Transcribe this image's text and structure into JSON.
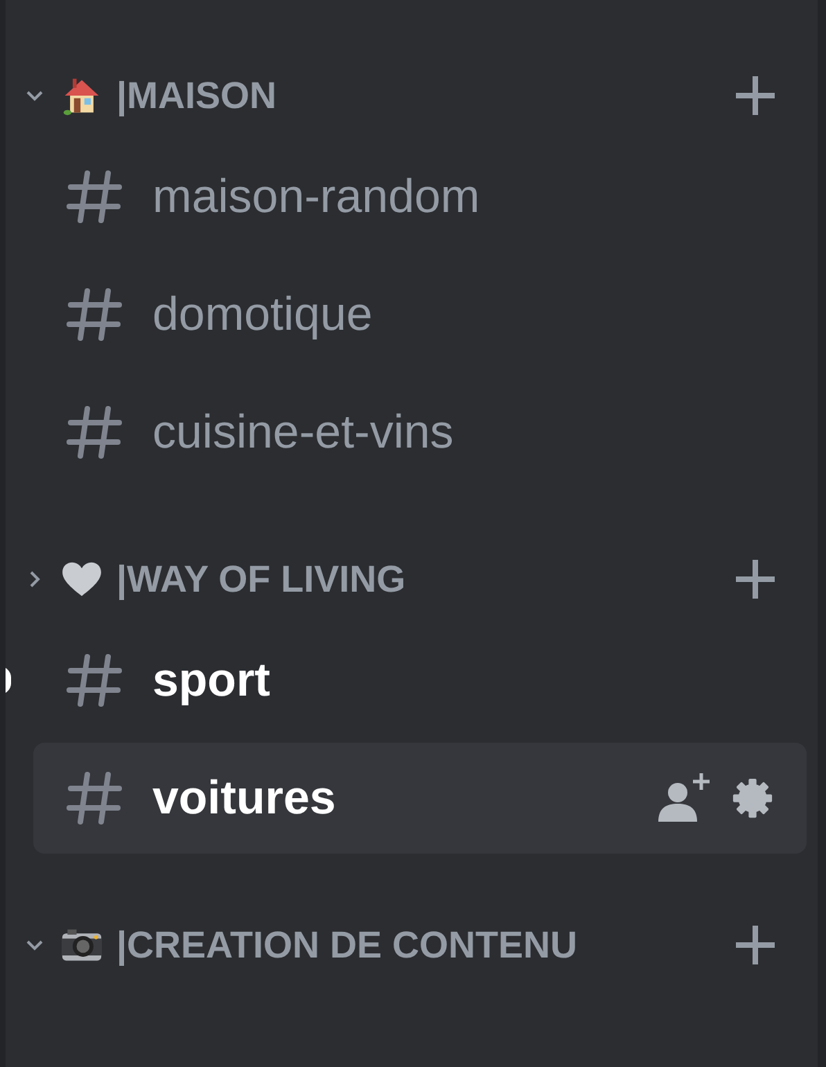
{
  "categories": [
    {
      "name": "|MAISON",
      "expanded": true,
      "channels": [
        {
          "name": "maison-random",
          "unread": false,
          "selected": false
        },
        {
          "name": "domotique",
          "unread": false,
          "selected": false
        },
        {
          "name": "cuisine-et-vins",
          "unread": false,
          "selected": false
        }
      ]
    },
    {
      "name": "|WAY OF LIVING",
      "expanded": false,
      "channels": [
        {
          "name": "sport",
          "unread": true,
          "selected": false
        },
        {
          "name": "voitures",
          "unread": false,
          "selected": true
        }
      ]
    },
    {
      "name": "|CREATION DE CONTENU",
      "expanded": true
    }
  ]
}
